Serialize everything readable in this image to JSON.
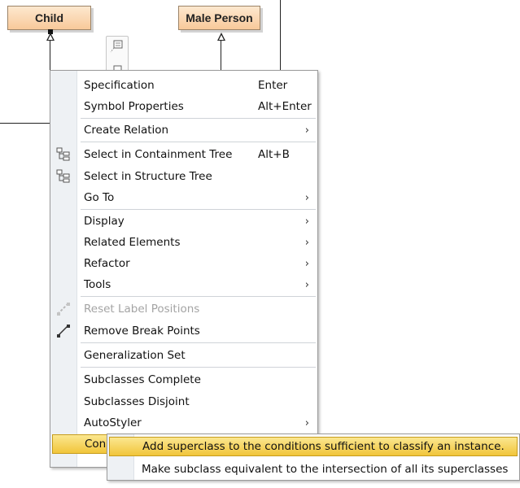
{
  "diagram": {
    "classes": [
      {
        "name": "Child"
      },
      {
        "name": "Male Person"
      }
    ]
  },
  "menu": {
    "items": [
      {
        "label": "Specification",
        "shortcut": "Enter"
      },
      {
        "label": "Symbol Properties",
        "shortcut": "Alt+Enter"
      },
      {
        "label": "Create Relation",
        "submenu": "›"
      },
      {
        "label": "Select in Containment Tree",
        "shortcut": "Alt+B",
        "icon": "containment-tree-icon"
      },
      {
        "label": "Select in Structure Tree",
        "icon": "structure-tree-icon"
      },
      {
        "label": "Go To",
        "submenu": "›"
      },
      {
        "label": "Display",
        "submenu": "›"
      },
      {
        "label": "Related Elements",
        "submenu": "›"
      },
      {
        "label": "Refactor",
        "submenu": "›"
      },
      {
        "label": "Tools",
        "submenu": "›"
      },
      {
        "label": "Reset Label Positions",
        "disabled": true,
        "icon": "reset-labels-icon"
      },
      {
        "label": "Remove Break Points",
        "icon": "remove-break-points-icon"
      },
      {
        "label": "Generalization Set"
      },
      {
        "label": "Subclasses Complete"
      },
      {
        "label": "Subclasses Disjoint"
      },
      {
        "label": "AutoStyler",
        "submenu": "›"
      },
      {
        "label": "Con",
        "highlighted": true
      }
    ]
  },
  "submenu": {
    "items": [
      {
        "label": "Add superclass to the conditions sufficient to classify an instance.",
        "highlighted": true
      },
      {
        "label": "Make subclass equivalent to the intersection of all its superclasses"
      }
    ]
  },
  "colors": {
    "highlight": "#f5d35a",
    "class_fill": "#fbd8b0",
    "gutter": "#eef1f4"
  }
}
